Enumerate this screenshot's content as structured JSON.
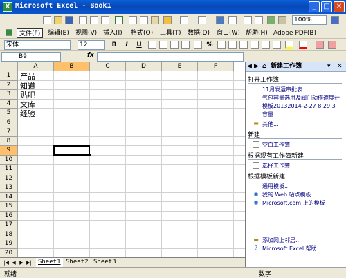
{
  "window": {
    "title": "Microsoft Excel - Book1",
    "buttons": {
      "minimize": "_",
      "maximize": "□",
      "close": "✕"
    }
  },
  "toolbar": {
    "zoom": "100%"
  },
  "menubar": {
    "items": [
      "文件(F)",
      "编辑(E)",
      "视图(V)",
      "插入(I)",
      "格式(O)",
      "工具(T)",
      "数据(D)",
      "窗口(W)",
      "帮助(H)",
      "Adobe PDF(B)"
    ]
  },
  "format_bar": {
    "font": "宋体",
    "size": "12",
    "bold": "B",
    "italic": "I",
    "underline": "U",
    "percent": "%"
  },
  "formula_bar": {
    "name_box": "B9",
    "fx": "fx"
  },
  "grid": {
    "columns": [
      "A",
      "B",
      "C",
      "D",
      "E",
      "F"
    ],
    "rows": [
      "1",
      "2",
      "3",
      "4",
      "5",
      "6",
      "7",
      "8",
      "9",
      "10",
      "11",
      "12",
      "13",
      "14",
      "15",
      "16",
      "17",
      "18",
      "19",
      "20"
    ],
    "cells_a": [
      "产品",
      "知道",
      "贴吧",
      "文库",
      "经验"
    ],
    "active_cell": "B9"
  },
  "sheets": {
    "tabs": [
      "Sheet1",
      "Sheet2",
      "Sheet3"
    ],
    "active": "Sheet1"
  },
  "status": {
    "left": "就绪",
    "right": "数字"
  },
  "task_pane": {
    "title": "新建工作簿",
    "open_section": "打开工作簿",
    "recent": [
      "11月发运审批表",
      "气包容量选用及阀门动作速度计",
      "模板20132014-2-27 8.29.3",
      "容量"
    ],
    "more": "其他...",
    "new_section": "新建",
    "blank": "空白工作簿",
    "from_existing_section": "根据现有工作簿新建",
    "choose": "选择工作簿...",
    "template_section": "根据模板新建",
    "templates": [
      "通用模板...",
      "我的 Web 站点模板...",
      "Microsoft.com 上的模板"
    ],
    "footer": [
      "添加网上邻居...",
      "Microsoft Excel 帮助"
    ]
  }
}
